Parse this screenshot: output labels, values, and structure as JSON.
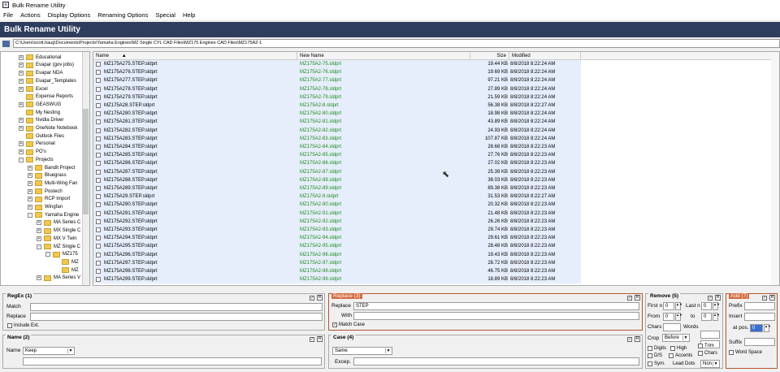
{
  "window": {
    "title": "Bulk Rename Utility"
  },
  "menu": [
    "File",
    "Actions",
    "Display Options",
    "Renaming Options",
    "Special",
    "Help"
  ],
  "banner": "Bulk Rename Utility",
  "path": "C:\\Users\\scott.haug\\Documents\\Projects\\Yamaha Engines\\MZ Single CYL CAD Files\\MZ175 Engines CAD Files\\MZ175A2-1",
  "tree": [
    {
      "label": "Educational",
      "x": 22,
      "exp": "+"
    },
    {
      "label": "Evapar (gov jobs)",
      "x": 22,
      "exp": "+"
    },
    {
      "label": "Evapar NDA",
      "x": 22,
      "exp": "+"
    },
    {
      "label": "Evapar_Templates",
      "x": 22,
      "exp": "+"
    },
    {
      "label": "Excel",
      "x": 22,
      "exp": "+"
    },
    {
      "label": "Expense Reports",
      "x": 22,
      "exp": ""
    },
    {
      "label": "GEASWUG",
      "x": 22,
      "exp": "+"
    },
    {
      "label": "My Nesting",
      "x": 22,
      "exp": ""
    },
    {
      "label": "Nvidia Driver",
      "x": 22,
      "exp": "+"
    },
    {
      "label": "OneNote Notebook",
      "x": 22,
      "exp": "+"
    },
    {
      "label": "Outlook Files",
      "x": 22,
      "exp": ""
    },
    {
      "label": "Personal",
      "x": 22,
      "exp": "+"
    },
    {
      "label": "PO's",
      "x": 22,
      "exp": "+"
    },
    {
      "label": "Projects",
      "x": 22,
      "exp": "-"
    },
    {
      "label": "Bandit Project",
      "x": 33,
      "exp": "+"
    },
    {
      "label": "Bluegrass",
      "x": 33,
      "exp": "+"
    },
    {
      "label": "Multi-Wing Fan",
      "x": 33,
      "exp": "+"
    },
    {
      "label": "Postech",
      "x": 33,
      "exp": "+"
    },
    {
      "label": "RCP Import",
      "x": 33,
      "exp": "+"
    },
    {
      "label": "Wingfan",
      "x": 33,
      "exp": "+"
    },
    {
      "label": "Yamaha Engine",
      "x": 33,
      "exp": "-"
    },
    {
      "label": "MA Series C",
      "x": 44,
      "exp": "+"
    },
    {
      "label": "MX Single C",
      "x": 44,
      "exp": "+"
    },
    {
      "label": "MX V Twin",
      "x": 44,
      "exp": "+"
    },
    {
      "label": "MZ Single C",
      "x": 44,
      "exp": "-"
    },
    {
      "label": "MZ175",
      "x": 55,
      "exp": "-"
    },
    {
      "label": "MZ",
      "x": 66,
      "exp": ""
    },
    {
      "label": "MZ",
      "x": 66,
      "exp": ""
    },
    {
      "label": "MA Series V",
      "x": 44,
      "exp": "+"
    }
  ],
  "columns": {
    "name": "Name",
    "new_name": "New Name",
    "size": "Size",
    "modified": "Modified"
  },
  "files": [
    {
      "name": "MZ175A275.STEP.sldprt",
      "new": "MZ175A2-75.sldprt",
      "size": "19.44 KB",
      "mod": "8/8/2018 8:22:24 AM"
    },
    {
      "name": "MZ175A276.STEP.sldprt",
      "new": "MZ175A2-76.sldprt",
      "size": "19.69 KB",
      "mod": "8/8/2018 8:22:24 AM"
    },
    {
      "name": "MZ175A277.STEP.sldprt",
      "new": "MZ175A2-77.sldprt",
      "size": "97.21 KB",
      "mod": "8/8/2018 8:22:24 AM"
    },
    {
      "name": "MZ175A278.STEP.sldprt",
      "new": "MZ175A2-78.sldprt",
      "size": "27.89 KB",
      "mod": "8/8/2018 8:22:24 AM"
    },
    {
      "name": "MZ175A279.STEP.sldprt",
      "new": "MZ175A2-79.sldprt",
      "size": "21.59 KB",
      "mod": "8/8/2018 8:22:24 AM"
    },
    {
      "name": "MZ175A28.STEP.sldprt",
      "new": "MZ175A2-8.sldprt",
      "size": "56.38 KB",
      "mod": "8/8/2018 8:22:27 AM"
    },
    {
      "name": "MZ175A280.STEP.sldprt",
      "new": "MZ175A2-80.sldprt",
      "size": "18.98 KB",
      "mod": "8/8/2018 8:22:24 AM"
    },
    {
      "name": "MZ175A281.STEP.sldprt",
      "new": "MZ175A2-81.sldprt",
      "size": "43.89 KB",
      "mod": "8/8/2018 8:22:24 AM"
    },
    {
      "name": "MZ175A282.STEP.sldprt",
      "new": "MZ175A2-82.sldprt",
      "size": "24.93 KB",
      "mod": "8/8/2018 8:22:24 AM"
    },
    {
      "name": "MZ175A283.STEP.sldprt",
      "new": "MZ175A2-83.sldprt",
      "size": "107.87 KB",
      "mod": "8/8/2018 8:22:24 AM"
    },
    {
      "name": "MZ175A284.STEP.sldprt",
      "new": "MZ175A2-84.sldprt",
      "size": "28.68 KB",
      "mod": "8/8/2018 8:22:23 AM"
    },
    {
      "name": "MZ175A285.STEP.sldprt",
      "new": "MZ175A2-85.sldprt",
      "size": "27.76 KB",
      "mod": "8/8/2018 8:22:23 AM"
    },
    {
      "name": "MZ175A286.STEP.sldprt",
      "new": "MZ175A2-86.sldprt",
      "size": "27.02 KB",
      "mod": "8/8/2018 8:22:23 AM"
    },
    {
      "name": "MZ175A287.STEP.sldprt",
      "new": "MZ175A2-87.sldprt",
      "size": "25.39 KB",
      "mod": "8/8/2018 8:22:23 AM"
    },
    {
      "name": "MZ175A288.STEP.sldprt",
      "new": "MZ175A2-88.sldprt",
      "size": "38.03 KB",
      "mod": "8/8/2018 8:22:23 AM"
    },
    {
      "name": "MZ175A289.STEP.sldprt",
      "new": "MZ175A2-89.sldprt",
      "size": "89.38 KB",
      "mod": "8/8/2018 8:22:23 AM"
    },
    {
      "name": "MZ175A29.STEP.sldprt",
      "new": "MZ175A2-9.sldprt",
      "size": "31.53 KB",
      "mod": "8/8/2018 8:22:27 AM"
    },
    {
      "name": "MZ175A290.STEP.sldprt",
      "new": "MZ175A2-90.sldprt",
      "size": "20.32 KB",
      "mod": "8/8/2018 8:22:23 AM"
    },
    {
      "name": "MZ175A291.STEP.sldprt",
      "new": "MZ175A2-91.sldprt",
      "size": "21.48 KB",
      "mod": "8/8/2018 8:22:23 AM"
    },
    {
      "name": "MZ175A292.STEP.sldprt",
      "new": "MZ175A2-92.sldprt",
      "size": "26.26 KB",
      "mod": "8/8/2018 8:22:23 AM"
    },
    {
      "name": "MZ175A293.STEP.sldprt",
      "new": "MZ175A2-93.sldprt",
      "size": "29.74 KB",
      "mod": "8/8/2018 8:22:23 AM"
    },
    {
      "name": "MZ175A294.STEP.sldprt",
      "new": "MZ175A2-94.sldprt",
      "size": "29.61 KB",
      "mod": "8/8/2018 8:22:23 AM"
    },
    {
      "name": "MZ175A295.STEP.sldprt",
      "new": "MZ175A2-95.sldprt",
      "size": "28.48 KB",
      "mod": "8/8/2018 8:22:23 AM"
    },
    {
      "name": "MZ175A296.STEP.sldprt",
      "new": "MZ175A2-96.sldprt",
      "size": "19.43 KB",
      "mod": "8/8/2018 8:22:23 AM"
    },
    {
      "name": "MZ175A297.STEP.sldprt",
      "new": "MZ175A2-97.sldprt",
      "size": "28.72 KB",
      "mod": "8/8/2018 8:22:23 AM"
    },
    {
      "name": "MZ175A298.STEP.sldprt",
      "new": "MZ175A2-98.sldprt",
      "size": "46.75 KB",
      "mod": "8/8/2018 8:22:23 AM"
    },
    {
      "name": "MZ175A299.STEP.sldprt",
      "new": "MZ175A2-99.sldprt",
      "size": "18.89 KB",
      "mod": "8/8/2018 8:22:23 AM"
    }
  ],
  "regex": {
    "title": "RegEx (1)",
    "match_label": "Match",
    "replace_label": "Replace",
    "include_ext": "Include Ext."
  },
  "replace": {
    "title": "Replace (3)",
    "replace_label": "Replace",
    "replace_value": "STEP",
    "with_label": "With",
    "match_case": "Match Case"
  },
  "remove": {
    "title": "Remove (5)",
    "first_n": "First n",
    "last_n": "Last n",
    "from": "From",
    "to": "to",
    "chars": "Chars",
    "words": "Words",
    "crop": "Crop",
    "crop_value": "Before",
    "digits": "Digits",
    "high": "High",
    "ds": "D/S",
    "accents": "Accents",
    "trim": "Trim",
    "chars2": "Chars",
    "sym": "Sym.",
    "lead_dots": "Lead Dots",
    "lead_value": "Non",
    "first_val": "0",
    "last_val": "0",
    "from_val": "0",
    "to_val": "0"
  },
  "add": {
    "title": "Add (7)",
    "prefix": "Prefix",
    "insert": "Insert",
    "at_pos": "at pos.",
    "at_pos_value": "0",
    "suffix": "Suffix",
    "word_space": "Word Space"
  },
  "name_panel": {
    "title": "Name (2)",
    "label": "Name",
    "value": "Keep"
  },
  "case_panel": {
    "title": "Case (4)",
    "value": "Same",
    "excep_label": "Excep."
  },
  "colors": {
    "banner": "#2e3d5e",
    "new_name": "#1e8a1e",
    "row_bg": "#e6eefb",
    "active_panel": "#d46a3e"
  }
}
